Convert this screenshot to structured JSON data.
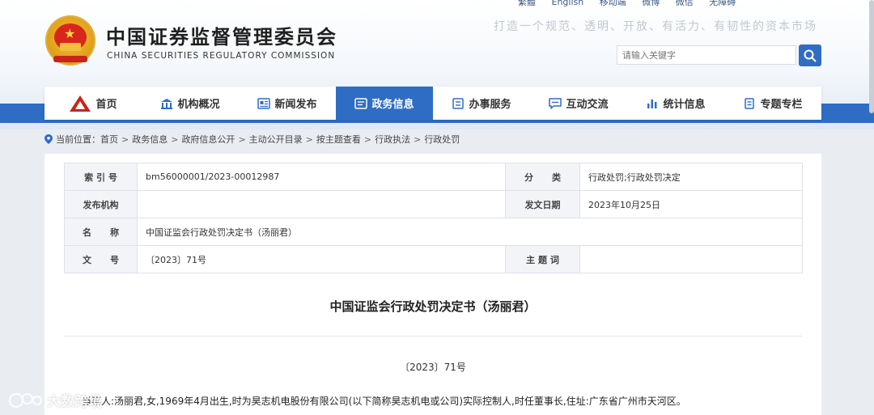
{
  "header": {
    "org_name_cn": "中国证券监督管理委员会",
    "org_name_en": "CHINA SECURITIES REGULATORY COMMISSION",
    "slogan": "打造一个规范、透明、开放、有活力、有韧性的资本市场",
    "top_links": [
      "繁體",
      "English",
      "移动端",
      "微博",
      "微信",
      "无障碍"
    ],
    "search_placeholder": "请输入关键字"
  },
  "nav": {
    "items": [
      {
        "label": "首页",
        "icon": "home-logo-icon"
      },
      {
        "label": "机构概况",
        "icon": "building-icon"
      },
      {
        "label": "新闻发布",
        "icon": "newspaper-icon"
      },
      {
        "label": "政务信息",
        "icon": "document-icon",
        "active": true
      },
      {
        "label": "办事服务",
        "icon": "service-icon"
      },
      {
        "label": "互动交流",
        "icon": "chat-icon"
      },
      {
        "label": "统计信息",
        "icon": "bar-chart-icon"
      },
      {
        "label": "专题专栏",
        "icon": "column-icon"
      }
    ]
  },
  "breadcrumb": {
    "prefix": "当前位置：",
    "items": [
      "首页",
      "政务信息",
      "政府信息公开",
      "主动公开目录",
      "按主题查看",
      "行政执法",
      "行政处罚"
    ]
  },
  "meta": {
    "index_label": "索 引 号",
    "index_value": "bm56000001/2023-00012987",
    "category_label": "分      类",
    "category_value": "行政处罚;行政处罚决定",
    "publisher_label": "发布机构",
    "publisher_value": "",
    "date_label": "发文日期",
    "date_value": "2023年10月25日",
    "name_label": "名      称",
    "name_value": "中国证监会行政处罚决定书（汤丽君）",
    "docno_label": "文      号",
    "docno_value": "〔2023〕71号",
    "subject_label": "主 题 词",
    "subject_value": ""
  },
  "document": {
    "title": "中国证监会行政处罚决定书（汤丽君）",
    "number": "〔2023〕71号",
    "paragraph": "当事人:汤丽君,女,1969年4月出生,时为昊志机电股份有限公司(以下简称昊志机电或公司)实际控制人,时任董事长,住址:广东省广州市天河区。"
  },
  "watermark": "大数跨境",
  "colors": {
    "primary": "#2f6dc5",
    "emblem_red": "#d8261c",
    "emblem_gold": "#e2a41c"
  }
}
